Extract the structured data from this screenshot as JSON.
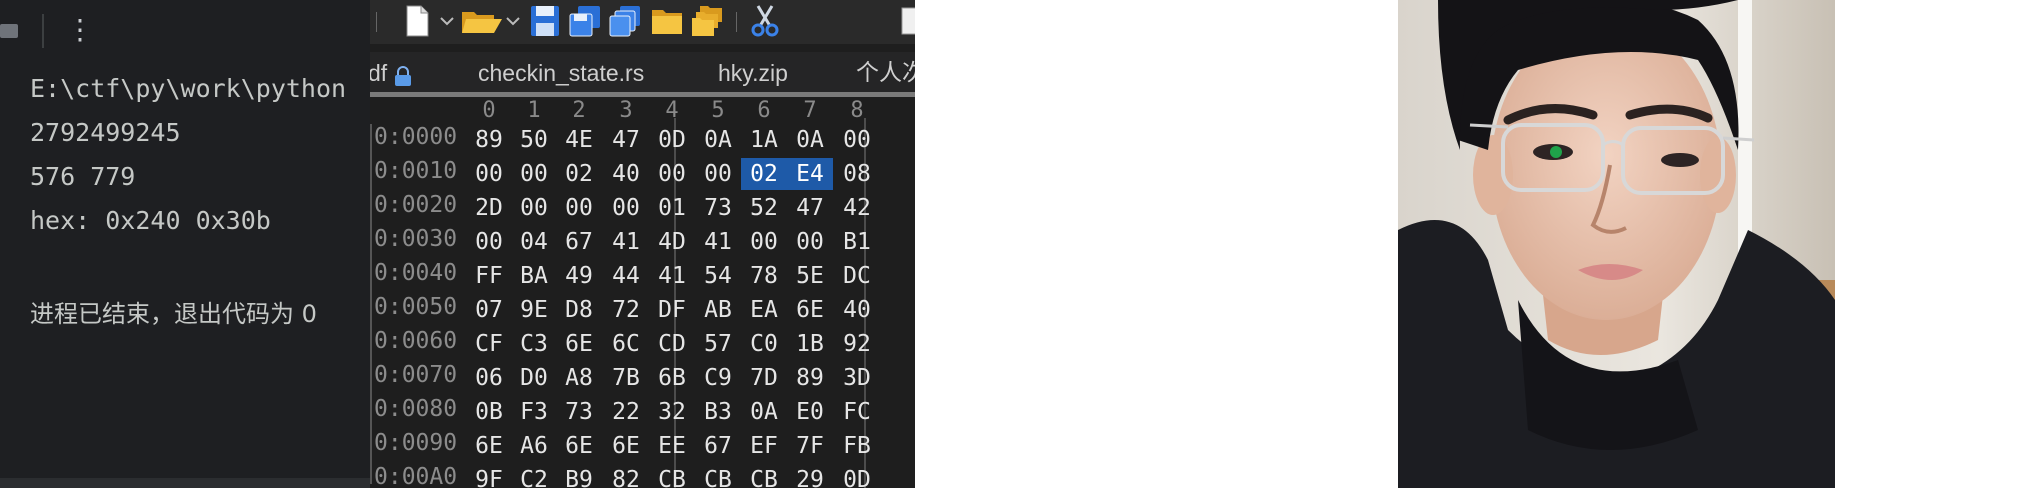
{
  "terminal": {
    "more_icon_glyph": "⋮",
    "lines": [
      "E:\\ctf\\py\\work\\python",
      "2792499245",
      "576 779",
      "hex: 0x240 0x30b",
      "",
      "进程已结束，退出代码为 0"
    ]
  },
  "hex_editor": {
    "tabs": [
      "df",
      "checkin_state.rs",
      "hky.zip",
      "个人次"
    ],
    "column_headers": [
      "0",
      "1",
      "2",
      "3",
      "4",
      "5",
      "6",
      "7",
      "8"
    ],
    "rows": [
      {
        "address": "0:0000",
        "bytes": [
          "89",
          "50",
          "4E",
          "47",
          "0D",
          "0A",
          "1A",
          "0A",
          "00"
        ]
      },
      {
        "address": "0:0010",
        "bytes": [
          "00",
          "00",
          "02",
          "40",
          "00",
          "00",
          "02",
          "E4",
          "08"
        ]
      },
      {
        "address": "0:0020",
        "bytes": [
          "2D",
          "00",
          "00",
          "00",
          "01",
          "73",
          "52",
          "47",
          "42"
        ]
      },
      {
        "address": "0:0030",
        "bytes": [
          "00",
          "04",
          "67",
          "41",
          "4D",
          "41",
          "00",
          "00",
          "B1"
        ]
      },
      {
        "address": "0:0040",
        "bytes": [
          "FF",
          "BA",
          "49",
          "44",
          "41",
          "54",
          "78",
          "5E",
          "DC"
        ]
      },
      {
        "address": "0:0050",
        "bytes": [
          "07",
          "9E",
          "D8",
          "72",
          "DF",
          "AB",
          "EA",
          "6E",
          "40"
        ]
      },
      {
        "address": "0:0060",
        "bytes": [
          "CF",
          "C3",
          "6E",
          "6C",
          "CD",
          "57",
          "C0",
          "1B",
          "92"
        ]
      },
      {
        "address": "0:0070",
        "bytes": [
          "06",
          "D0",
          "A8",
          "7B",
          "6B",
          "C9",
          "7D",
          "89",
          "3D"
        ]
      },
      {
        "address": "0:0080",
        "bytes": [
          "0B",
          "F3",
          "73",
          "22",
          "32",
          "B3",
          "0A",
          "E0",
          "FC"
        ]
      },
      {
        "address": "0:0090",
        "bytes": [
          "6E",
          "A6",
          "6E",
          "6E",
          "EE",
          "67",
          "EF",
          "7F",
          "FB"
        ]
      },
      {
        "address": "0:00A0",
        "bytes": [
          "9F",
          "C2",
          "B9",
          "82",
          "CB",
          "CB",
          "CB",
          "29",
          "0D"
        ]
      }
    ],
    "selected_row_index": 1,
    "selected_byte_indices": [
      6,
      7
    ],
    "selection_color": "#1e5aa8",
    "toolbar_icons": [
      "new-file-icon",
      "open-folder-icon",
      "save-icon",
      "save-as-icon",
      "save-all-icon",
      "folder-icon",
      "folders-icon",
      "cut-icon",
      "copy-icon"
    ]
  },
  "colors": {
    "terminal_bg": "#1e1f22",
    "terminal_text": "#c5c8c6",
    "hex_bg": "#1e1e1e",
    "hex_text": "#e6e6e6",
    "address_text": "#8c8c8c"
  }
}
